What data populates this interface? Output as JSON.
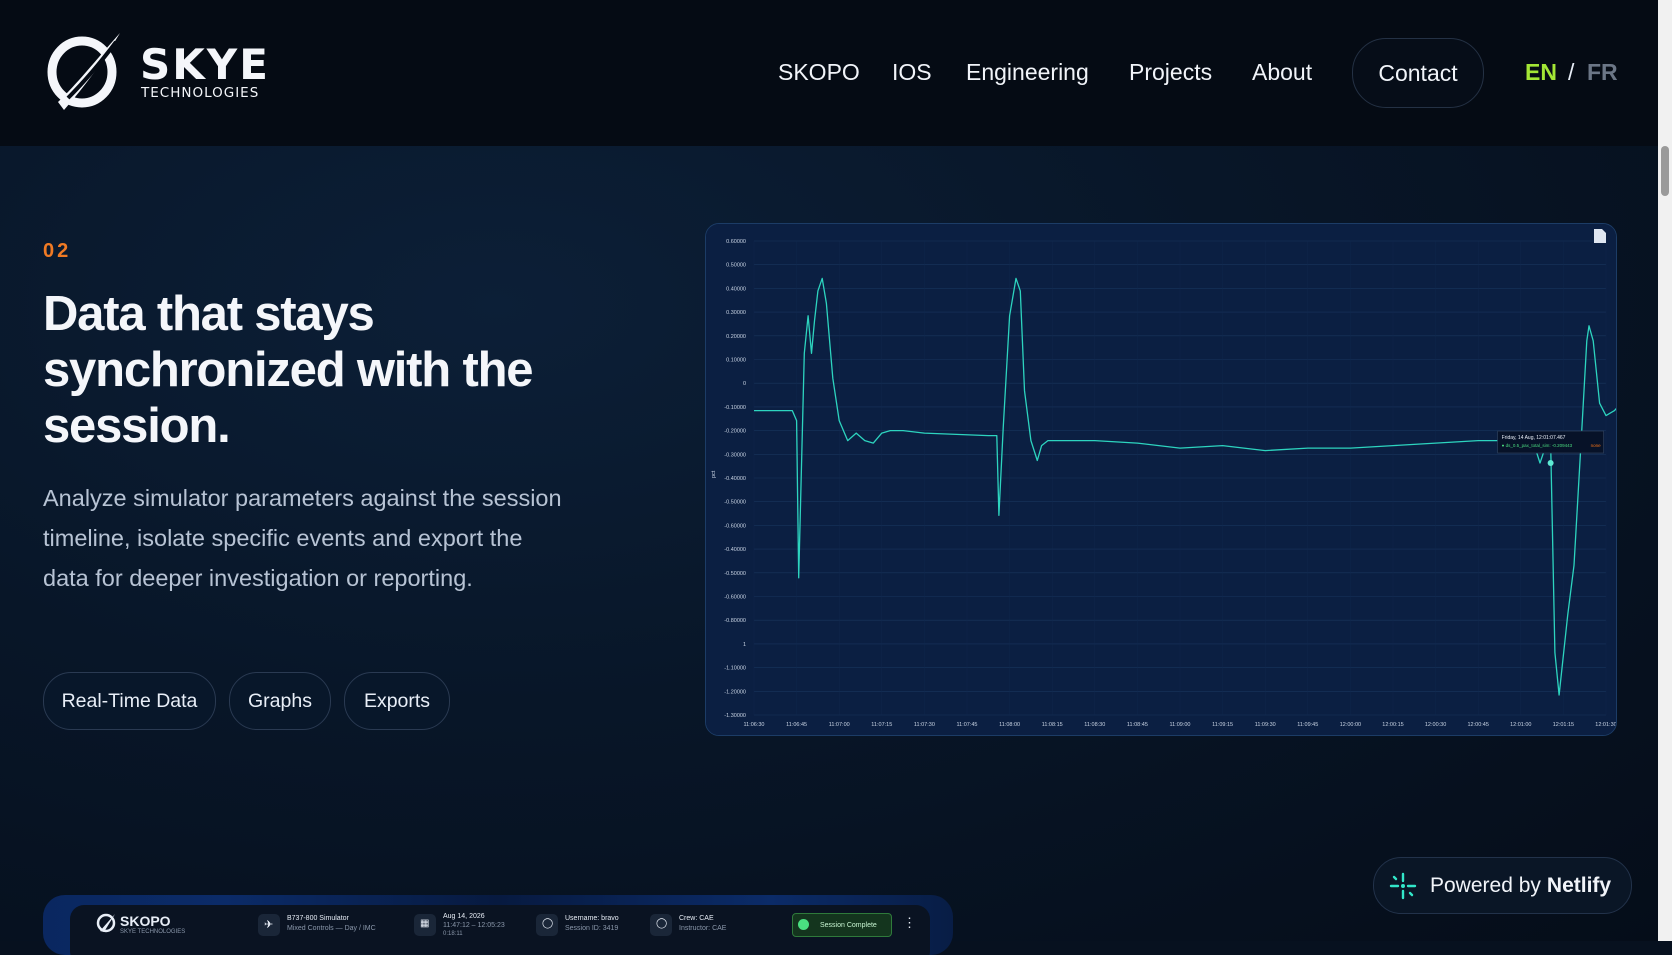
{
  "brand": {
    "name": "SKYE",
    "subtitle": "TECHNOLOGIES"
  },
  "nav": {
    "links": [
      "SKOPO",
      "IOS",
      "Engineering",
      "Projects",
      "About"
    ],
    "contact": "Contact",
    "lang_en": "EN",
    "lang_sep": "/",
    "lang_fr": "FR"
  },
  "section": {
    "number": "02",
    "title": "Data that stays synchronized with the session.",
    "description": "Analyze simulator parameters against the session timeline, isolate specific events and export the data for deeper investigation or reporting.",
    "tags": [
      "Real-Time Data",
      "Graphs",
      "Exports"
    ]
  },
  "chart_data": {
    "type": "line",
    "ylabel": "pct",
    "yticks": [
      "0.60000",
      "0.50000",
      "0.40000",
      "0.30000",
      "0.20000",
      "0.10000",
      "0",
      "-0.10000",
      "-0.20000",
      "-0.30000",
      "-0.40000",
      "-0.50000",
      "-0.60000",
      "-0.40000",
      "-0.50000",
      "-0.60000",
      "-0.80000",
      "1",
      "-1.10000",
      "-1.20000",
      "-1.30000"
    ],
    "xticks": [
      "11:06:30",
      "11:06:45",
      "11:07:00",
      "11:07:15",
      "11:07:30",
      "11:07:45",
      "11:08:00",
      "11:08:15",
      "11:08:30",
      "11:08:45",
      "11:09:00",
      "11:09:15",
      "11:09:30",
      "11:09:45",
      "12:00:00",
      "12:00:15",
      "12:00:30",
      "12:00:45",
      "12:01:00",
      "12:01:15",
      "12:01:30"
    ],
    "ylim": [
      -1.3,
      0.6
    ],
    "series": [
      {
        "color": "#2dd4bf",
        "points": [
          [
            0,
            -0.08
          ],
          [
            0.9,
            -0.08
          ],
          [
            1.0,
            -0.12
          ],
          [
            1.05,
            -0.75
          ],
          [
            1.18,
            0.15
          ],
          [
            1.27,
            0.3
          ],
          [
            1.35,
            0.15
          ],
          [
            1.42,
            0.28
          ],
          [
            1.5,
            0.4
          ],
          [
            1.6,
            0.45
          ],
          [
            1.7,
            0.35
          ],
          [
            1.85,
            0.05
          ],
          [
            2.0,
            -0.12
          ],
          [
            2.2,
            -0.2
          ],
          [
            2.4,
            -0.17
          ],
          [
            2.6,
            -0.2
          ],
          [
            2.8,
            -0.21
          ],
          [
            3.0,
            -0.17
          ],
          [
            3.2,
            -0.16
          ],
          [
            3.5,
            -0.16
          ],
          [
            4.0,
            -0.17
          ],
          [
            5.5,
            -0.18
          ],
          [
            5.7,
            -0.18
          ],
          [
            5.75,
            -0.5
          ],
          [
            5.85,
            -0.15
          ],
          [
            6.0,
            0.3
          ],
          [
            6.15,
            0.45
          ],
          [
            6.25,
            0.4
          ],
          [
            6.35,
            0.0
          ],
          [
            6.5,
            -0.2
          ],
          [
            6.65,
            -0.28
          ],
          [
            6.75,
            -0.22
          ],
          [
            6.9,
            -0.2
          ],
          [
            8.0,
            -0.2
          ],
          [
            9.0,
            -0.21
          ],
          [
            10.0,
            -0.23
          ],
          [
            11.0,
            -0.22
          ],
          [
            12.0,
            -0.24
          ],
          [
            13.0,
            -0.23
          ],
          [
            14.0,
            -0.23
          ],
          [
            15.0,
            -0.22
          ],
          [
            16.0,
            -0.21
          ],
          [
            17.0,
            -0.2
          ],
          [
            18.0,
            -0.2
          ],
          [
            18.3,
            -0.21
          ],
          [
            18.45,
            -0.29
          ],
          [
            18.55,
            -0.24
          ],
          [
            18.7,
            -0.2
          ],
          [
            18.8,
            -1.05
          ],
          [
            18.9,
            -1.22
          ],
          [
            19.1,
            -0.9
          ],
          [
            19.25,
            -0.7
          ],
          [
            19.35,
            -0.4
          ],
          [
            19.45,
            -0.1
          ],
          [
            19.55,
            0.2
          ],
          [
            19.6,
            0.26
          ],
          [
            19.7,
            0.2
          ],
          [
            19.85,
            -0.05
          ],
          [
            20.0,
            -0.1
          ],
          [
            20.2,
            -0.08
          ],
          [
            20.3,
            -0.06
          ],
          [
            20.35,
            -0.2
          ]
        ]
      }
    ],
    "tooltip": {
      "title": "Friday, 14 Aug, 12:01:07.467",
      "line": "● ds_0.5_pax_total_sim: -0.209443",
      "unit": "none"
    }
  },
  "netlify": {
    "prefix": "Powered by",
    "name": "Netlify"
  },
  "preview_bar": {
    "brand": "SKOPO",
    "brand_sub": "SKYE TECHNOLOGIES",
    "aircraft": "B737-800 Simulator",
    "aircraft_sub": "Mixed Controls — Day / IMC",
    "date": "Aug 14, 2026",
    "time": "11:47:12 – 12:05:23",
    "duration": "0:18:11",
    "username": "Username: bravo",
    "session_id": "Session ID: 3419",
    "crew": "Crew: CAE",
    "instructor": "Instructor: CAE",
    "status": "Session Complete"
  }
}
